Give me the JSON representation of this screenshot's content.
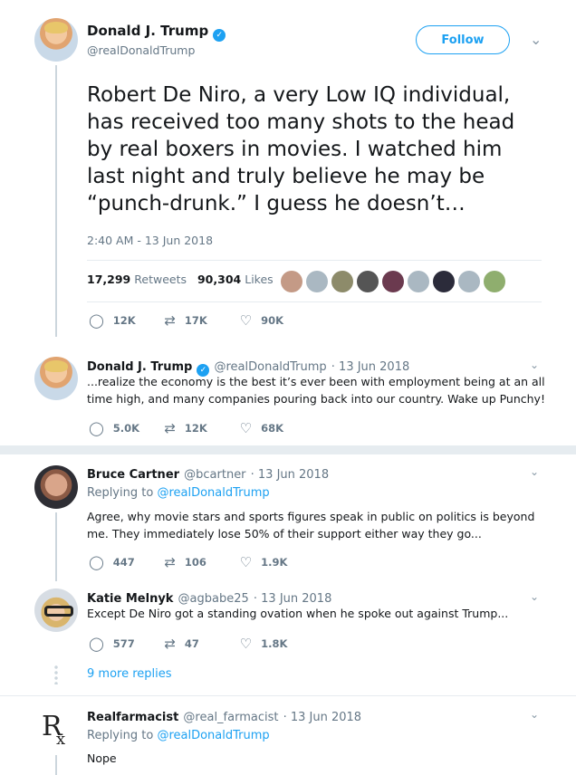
{
  "main_tweet": {
    "name": "Donald J. Trump",
    "handle": "@realDonaldTrump",
    "follow_label": "Follow",
    "text": "Robert De Niro, a very Low IQ individual, has received too many shots to the head by real boxers in movies. I watched him last night and truly believe he may be “punch-drunk.” I guess he doesn’t…",
    "timestamp": "2:40 AM - 13 Jun 2018",
    "retweets_count": "17,299",
    "retweets_label": "Retweets",
    "likes_count": "90,304",
    "likes_label": "Likes",
    "replies": "12K",
    "retweets": "17K",
    "likes": "90K"
  },
  "thread_tweet": {
    "name": "Donald J. Trump",
    "handle": "@realDonaldTrump",
    "date": "· 13 Jun 2018",
    "text": "...realize the economy is the best it’s ever been with employment being at an all time high, and many companies pouring back into our country. Wake up Punchy!",
    "replies": "5.0K",
    "retweets": "12K",
    "likes": "68K"
  },
  "replies_list": [
    {
      "name": "Bruce Cartner",
      "handle": "@bcartner",
      "date": "· 13 Jun 2018",
      "replying_label": "Replying to",
      "replying_to": "@realDonaldTrump",
      "text": "Agree, why movie stars and sports figures speak in public on politics is beyond me. They immediately lose 50% of their support either way they go...",
      "replies": "447",
      "retweets": "106",
      "likes": "1.9K"
    },
    {
      "name": "Katie Melnyk",
      "handle": "@agbabe25",
      "date": "· 13 Jun 2018",
      "text": "Except De Niro got a standing ovation when he spoke out against Trump...",
      "replies": "577",
      "retweets": "47",
      "likes": "1.8K"
    },
    {
      "name": "Realfarmacist",
      "handle": "@real_farmacist",
      "date": "· 13 Jun 2018",
      "replying_label": "Replying to",
      "replying_to": "@realDonaldTrump",
      "text": "Nope"
    }
  ],
  "more_replies": "9 more replies",
  "icons": {
    "verified": "✓",
    "reply": "◯",
    "retweet": "⇄",
    "like": "♡",
    "chevron": "⌄"
  },
  "colors": {
    "accent": "#1da1f2",
    "muted": "#657786"
  }
}
